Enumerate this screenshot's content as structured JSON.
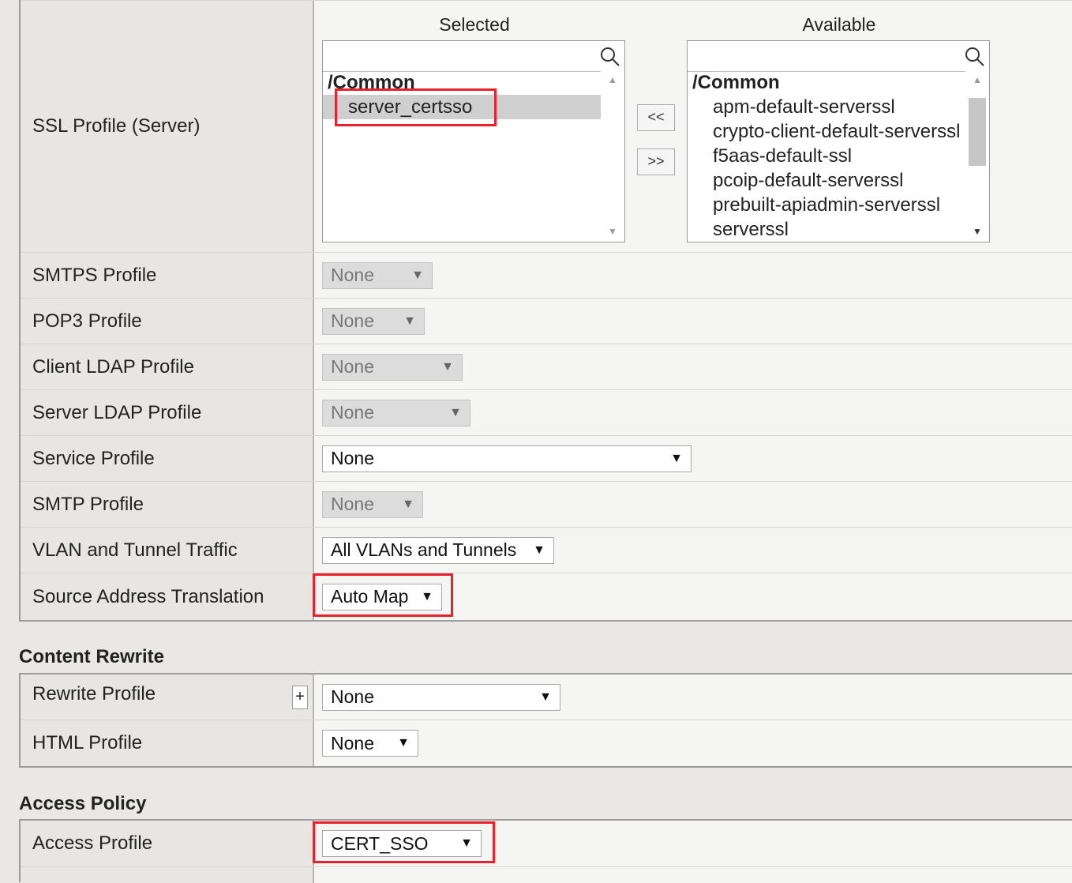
{
  "ssl_server": {
    "label": "SSL Profile (Server)",
    "selected_title": "Selected",
    "available_title": "Available",
    "selected_group": "/Common",
    "selected_items": [
      "server_certsso"
    ],
    "available_group": "/Common",
    "available_items": [
      "apm-default-serverssl",
      "crypto-client-default-serverssl",
      "f5aas-default-ssl",
      "pcoip-default-serverssl",
      "prebuilt-apiadmin-serverssl",
      "serverssl"
    ],
    "move_left": "<<",
    "move_right": ">>"
  },
  "rows": [
    {
      "label": "SMTPS Profile",
      "value": "None",
      "disabled": true
    },
    {
      "label": "POP3 Profile",
      "value": "None",
      "disabled": true
    },
    {
      "label": "Client LDAP Profile",
      "value": "None",
      "disabled": true
    },
    {
      "label": "Server LDAP Profile",
      "value": "None",
      "disabled": true
    },
    {
      "label": "Service Profile",
      "value": "None",
      "disabled": false
    },
    {
      "label": "SMTP Profile",
      "value": "None",
      "disabled": true
    },
    {
      "label": "VLAN and Tunnel Traffic",
      "value": "All VLANs and Tunnels",
      "disabled": false
    },
    {
      "label": "Source Address Translation",
      "value": "Auto Map",
      "disabled": false
    }
  ],
  "content_rewrite": {
    "title": "Content Rewrite",
    "rewrite_label": "Rewrite Profile",
    "rewrite_plus": "+",
    "rewrite_value": "None",
    "html_label": "HTML Profile",
    "html_value": "None"
  },
  "access_policy": {
    "title": "Access Policy",
    "access_label": "Access Profile",
    "access_value": "CERT_SSO"
  },
  "icons": {
    "search": "search-icon",
    "dropdown": "dropdown-arrow-icon"
  },
  "colors": {
    "highlight": "#e8212c",
    "label_bg": "#e7e6e3",
    "value_bg": "#f5f5f4"
  }
}
